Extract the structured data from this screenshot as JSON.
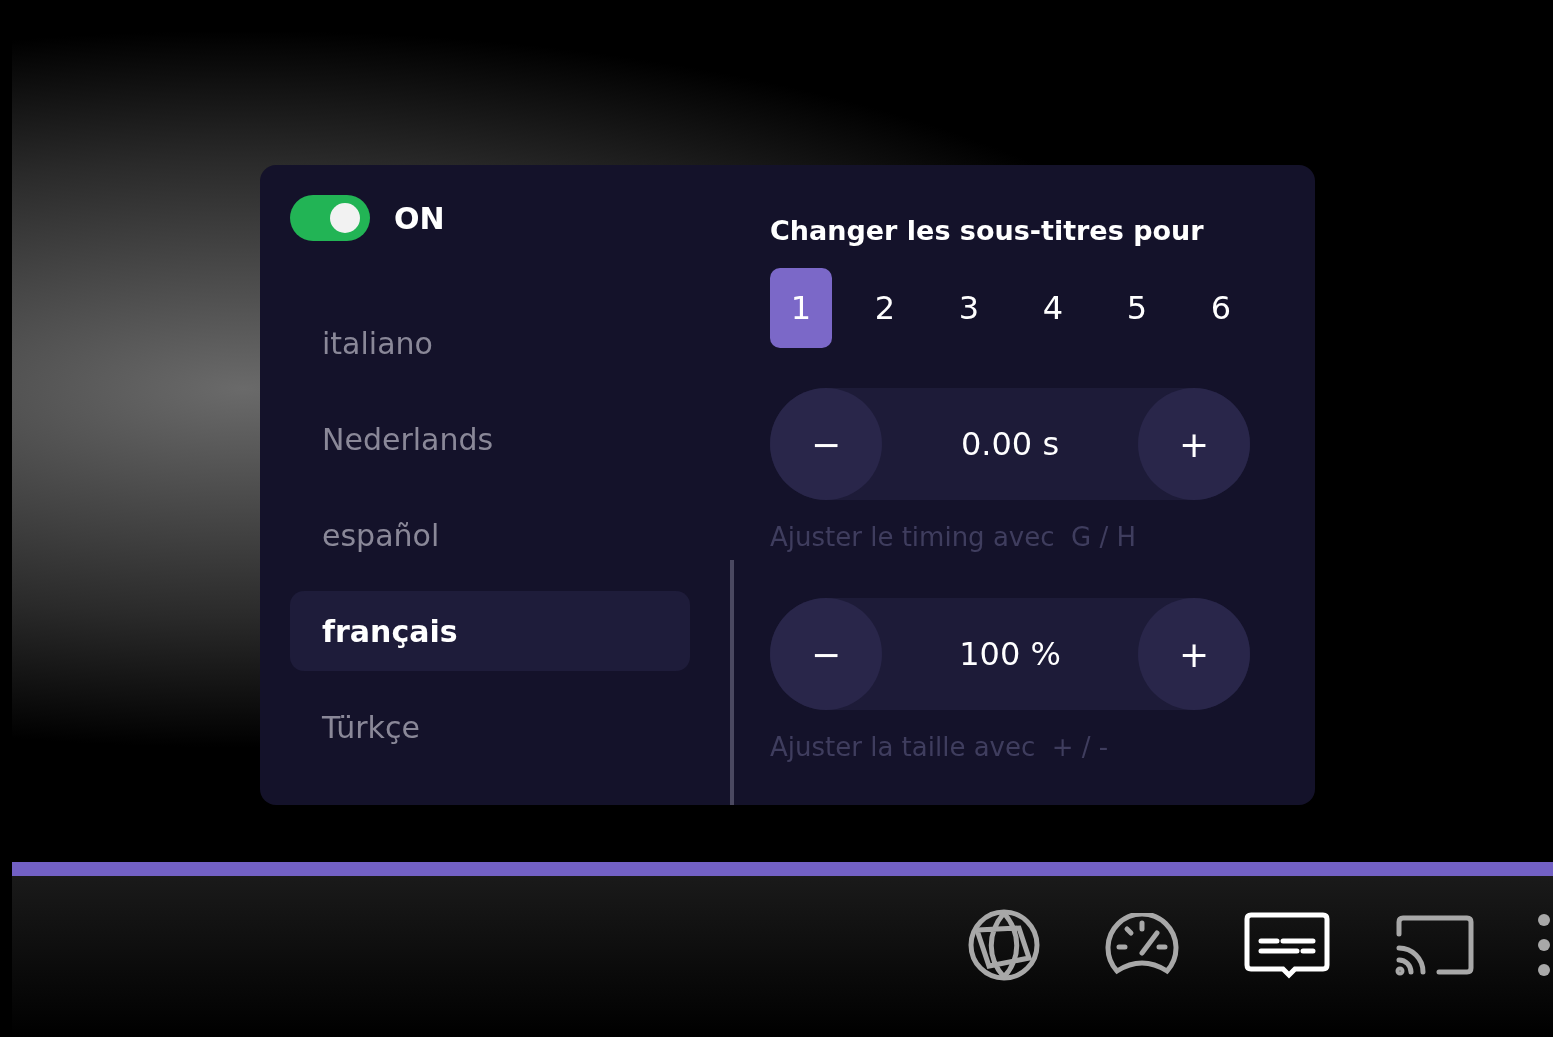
{
  "subtitles_panel": {
    "toggle": {
      "on": true,
      "label": "ON"
    },
    "languages": [
      {
        "label": "italiano",
        "selected": false
      },
      {
        "label": "Nederlands",
        "selected": false
      },
      {
        "label": "español",
        "selected": false
      },
      {
        "label": "français",
        "selected": true
      },
      {
        "label": "Türkçe",
        "selected": false
      }
    ],
    "title": "Changer les sous-titres pour",
    "tracks": [
      {
        "label": "1",
        "selected": true
      },
      {
        "label": "2",
        "selected": false
      },
      {
        "label": "3",
        "selected": false
      },
      {
        "label": "4",
        "selected": false
      },
      {
        "label": "5",
        "selected": false
      },
      {
        "label": "6",
        "selected": false
      }
    ],
    "steppers": [
      {
        "minus": "−",
        "value": "0.00 s",
        "plus": "+",
        "hint": "Ajuster le timing avec  G / H"
      },
      {
        "minus": "−",
        "value": "100 %",
        "plus": "+",
        "hint": "Ajuster la taille avec  + / -"
      }
    ]
  },
  "progress": {
    "level": 1
  },
  "controls": [
    {
      "kind": "globe",
      "selected": false
    },
    {
      "kind": "speed",
      "selected": false
    },
    {
      "kind": "subtitles",
      "selected": true
    },
    {
      "kind": "cast",
      "selected": false
    },
    {
      "kind": "more",
      "selected": false
    }
  ]
}
